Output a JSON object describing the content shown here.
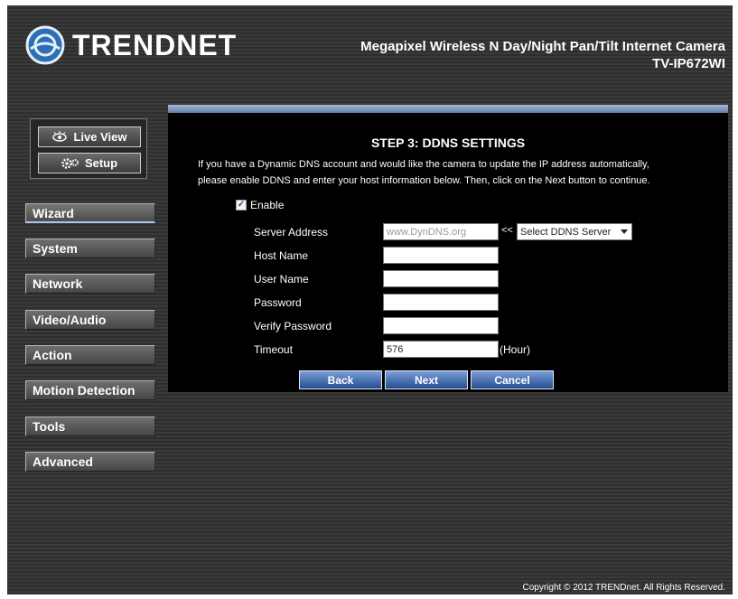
{
  "header": {
    "brand": "TRENDNET",
    "product_line1": "Megapixel Wireless N Day/Night Pan/Tilt Internet Camera",
    "product_line2": "TV-IP672WI"
  },
  "top_buttons": {
    "live_view": "Live View",
    "setup": "Setup"
  },
  "nav": {
    "items": [
      {
        "label": "Wizard"
      },
      {
        "label": "System"
      },
      {
        "label": "Network"
      },
      {
        "label": "Video/Audio"
      },
      {
        "label": "Action"
      },
      {
        "label": "Motion Detection"
      },
      {
        "label": "Tools"
      },
      {
        "label": "Advanced"
      }
    ]
  },
  "wizard": {
    "title": "STEP 3: DDNS SETTINGS",
    "desc_line1": "If you have a Dynamic DNS account and would like the camera to update the IP address automatically,",
    "desc_line2": "please enable DDNS and enter your host information below. Then, click on the Next button to continue.",
    "enable_label": "Enable",
    "enable_checked": true,
    "fields": {
      "server_address": {
        "label": "Server Address",
        "value": "www.DynDNS.org"
      },
      "host_name": {
        "label": "Host Name",
        "value": ""
      },
      "user_name": {
        "label": "User Name",
        "value": ""
      },
      "password": {
        "label": "Password",
        "value": ""
      },
      "verify_password": {
        "label": "Verify Password",
        "value": ""
      },
      "timeout": {
        "label": "Timeout",
        "value": "576",
        "unit": "(Hour)"
      }
    },
    "arrow": "<<",
    "ddns_select": "Select DDNS Server",
    "buttons": {
      "back": "Back",
      "next": "Next",
      "cancel": "Cancel"
    }
  },
  "footer": {
    "copyright": "Copyright © 2012 TRENDnet. All Rights Reserved."
  }
}
